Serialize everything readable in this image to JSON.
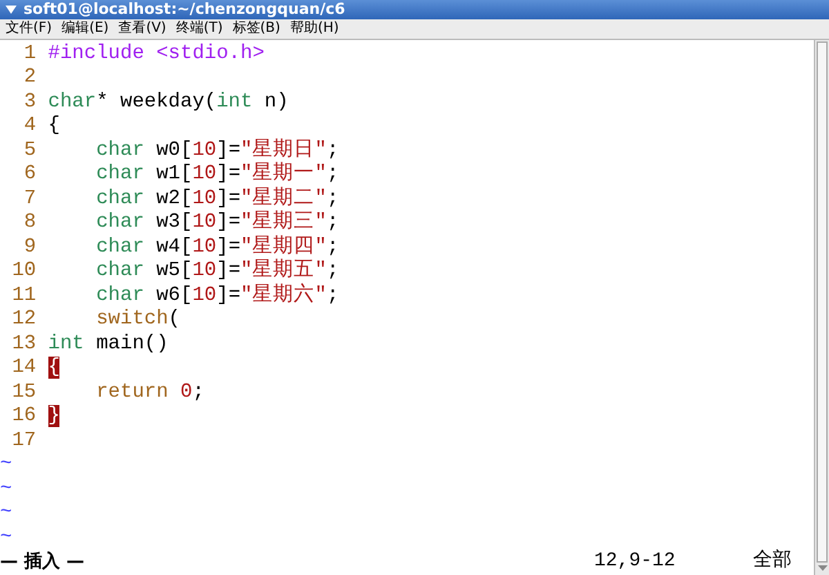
{
  "window": {
    "title": "soft01@localhost:~/chenzongquan/c6"
  },
  "menu": [
    "文件(F)",
    "编辑(E)",
    "查看(V)",
    "终端(T)",
    "标签(B)",
    "帮助(H)"
  ],
  "lines": [
    {
      "number": "1",
      "tokens": [
        {
          "text": "#include <stdio.h>",
          "kind": "preproc"
        }
      ]
    },
    {
      "number": "2"
    },
    {
      "number": "3",
      "tokens": [
        {
          "text": "char",
          "kind": "type"
        },
        {
          "text": "* weekday(",
          "kind": "plain"
        },
        {
          "text": "int",
          "kind": "type"
        },
        {
          "text": " n)",
          "kind": "plain"
        }
      ]
    },
    {
      "number": "4",
      "tokens": [
        {
          "text": "{",
          "kind": "plain"
        }
      ]
    },
    {
      "number": "5",
      "tokens": [
        {
          "text": "    char",
          "kind": "type"
        },
        {
          "text": " w0[",
          "kind": "plain"
        },
        {
          "text": "10",
          "kind": "constant"
        },
        {
          "text": "]=",
          "kind": "plain"
        },
        {
          "text": "\"星期日\"",
          "kind": "constant"
        },
        {
          "text": ";",
          "kind": "plain"
        }
      ]
    },
    {
      "number": "6",
      "tokens": [
        {
          "text": "    char",
          "kind": "type"
        },
        {
          "text": " w1[",
          "kind": "plain"
        },
        {
          "text": "10",
          "kind": "constant"
        },
        {
          "text": "]=",
          "kind": "plain"
        },
        {
          "text": "\"星期一\"",
          "kind": "constant"
        },
        {
          "text": ";",
          "kind": "plain"
        }
      ]
    },
    {
      "number": "7",
      "tokens": [
        {
          "text": "    char",
          "kind": "type"
        },
        {
          "text": " w2[",
          "kind": "plain"
        },
        {
          "text": "10",
          "kind": "constant"
        },
        {
          "text": "]=",
          "kind": "plain"
        },
        {
          "text": "\"星期二\"",
          "kind": "constant"
        },
        {
          "text": ";",
          "kind": "plain"
        }
      ]
    },
    {
      "number": "8",
      "tokens": [
        {
          "text": "    char",
          "kind": "type"
        },
        {
          "text": " w3[",
          "kind": "plain"
        },
        {
          "text": "10",
          "kind": "constant"
        },
        {
          "text": "]=",
          "kind": "plain"
        },
        {
          "text": "\"星期三\"",
          "kind": "constant"
        },
        {
          "text": ";",
          "kind": "plain"
        }
      ]
    },
    {
      "number": "9",
      "tokens": [
        {
          "text": "    char",
          "kind": "type"
        },
        {
          "text": " w4[",
          "kind": "plain"
        },
        {
          "text": "10",
          "kind": "constant"
        },
        {
          "text": "]=",
          "kind": "plain"
        },
        {
          "text": "\"星期四\"",
          "kind": "constant"
        },
        {
          "text": ";",
          "kind": "plain"
        }
      ]
    },
    {
      "number": "10",
      "tokens": [
        {
          "text": "    char",
          "kind": "type"
        },
        {
          "text": " w5[",
          "kind": "plain"
        },
        {
          "text": "10",
          "kind": "constant"
        },
        {
          "text": "]=",
          "kind": "plain"
        },
        {
          "text": "\"星期五\"",
          "kind": "constant"
        },
        {
          "text": ";",
          "kind": "plain"
        }
      ]
    },
    {
      "number": "11",
      "tokens": [
        {
          "text": "    char",
          "kind": "type"
        },
        {
          "text": " w6[",
          "kind": "plain"
        },
        {
          "text": "10",
          "kind": "constant"
        },
        {
          "text": "]=",
          "kind": "plain"
        },
        {
          "text": "\"星期六\"",
          "kind": "constant"
        },
        {
          "text": ";",
          "kind": "plain"
        }
      ]
    },
    {
      "number": "12",
      "tokens": [
        {
          "text": "    switch",
          "kind": "statement"
        },
        {
          "text": "(",
          "kind": "plain"
        }
      ]
    },
    {
      "number": "13",
      "tokens": [
        {
          "text": "int",
          "kind": "type"
        },
        {
          "text": " main()",
          "kind": "plain"
        }
      ]
    },
    {
      "number": "14",
      "tokens": [
        {
          "text": "{",
          "kind": "match"
        }
      ]
    },
    {
      "number": "15",
      "tokens": [
        {
          "text": "    return",
          "kind": "statement"
        },
        {
          "text": " 0",
          "kind": "constant"
        },
        {
          "text": ";",
          "kind": "plain"
        }
      ]
    },
    {
      "number": "16",
      "tokens": [
        {
          "text": "}",
          "kind": "match"
        }
      ]
    },
    {
      "number": "17"
    }
  ],
  "filler": [
    "~",
    "~",
    "~",
    "~"
  ],
  "status": {
    "mode": "— 插入 —",
    "position": "12,9-12",
    "scroll": "全部"
  }
}
